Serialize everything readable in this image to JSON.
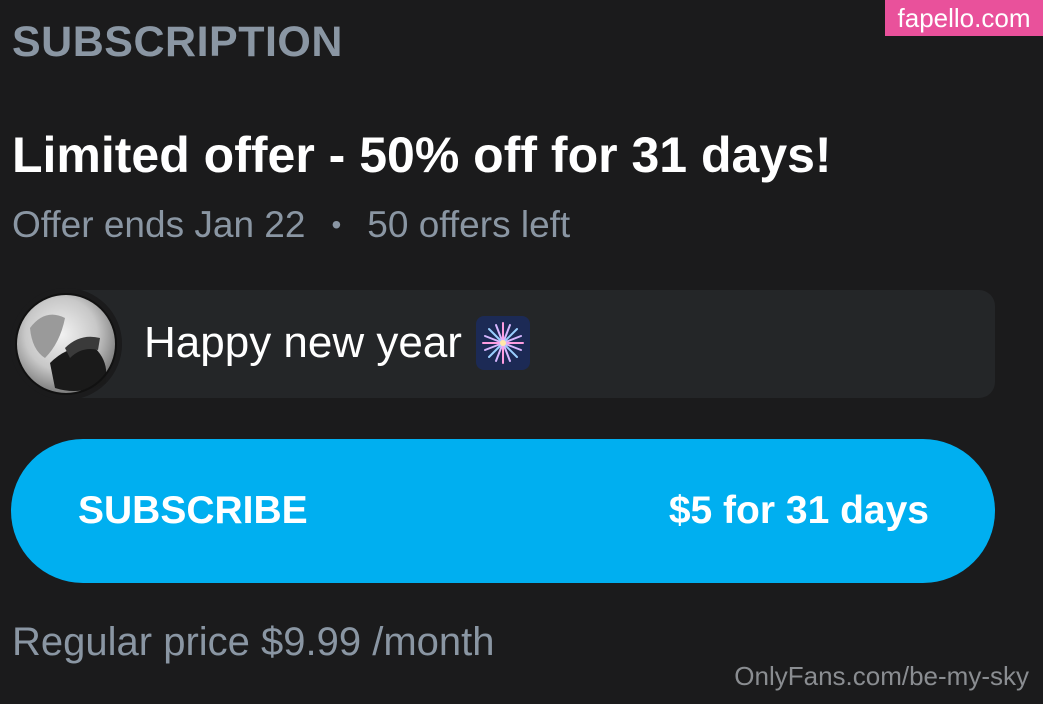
{
  "section": {
    "title": "SUBSCRIPTION"
  },
  "watermark": {
    "top": "fapello.com",
    "bottom": "OnlyFans.com/be-my-sky"
  },
  "offer": {
    "title": "Limited offer - 50% off for 31 days!",
    "ends": "Offer ends Jan 22",
    "separator": "•",
    "left": "50 offers left"
  },
  "message": {
    "text": "Happy new year",
    "emoji_icon": "fireworks-icon"
  },
  "subscribe": {
    "label": "SUBSCRIBE",
    "price": "$5 for 31 days"
  },
  "regular": {
    "price": "Regular price $9.99 /month"
  },
  "colors": {
    "background": "#1b1b1c",
    "accent": "#00aff0",
    "muted_text": "#8a96a3",
    "message_bg": "#242628",
    "watermark_pink": "#e9519b"
  }
}
